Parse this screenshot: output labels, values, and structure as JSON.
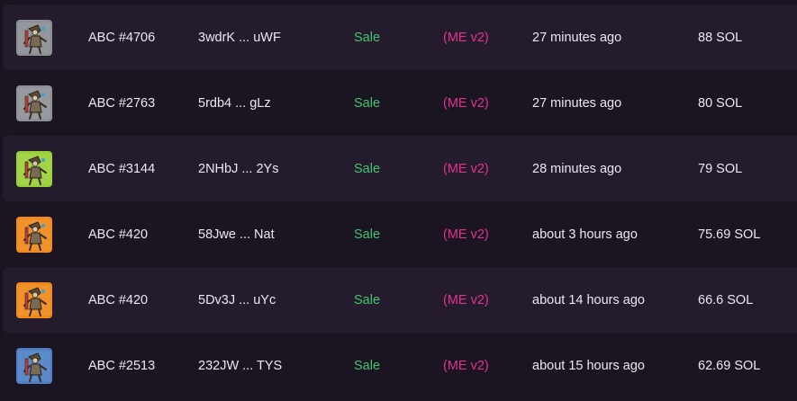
{
  "activity": {
    "rows": [
      {
        "name": "ABC #4706",
        "tx": "3wdrK ... uWF",
        "type": "Sale",
        "market": "(ME v2)",
        "time": "27 minutes ago",
        "price": "88 SOL",
        "thumb_bg": "#8a8f94",
        "thumb_icon": "nft-character-thumbnail"
      },
      {
        "name": "ABC #2763",
        "tx": "5rdb4 ... gLz",
        "type": "Sale",
        "market": "(ME v2)",
        "time": "27 minutes ago",
        "price": "80 SOL",
        "thumb_bg": "#8e9297",
        "thumb_icon": "nft-character-thumbnail"
      },
      {
        "name": "ABC #3144",
        "tx": "2NHbJ ... 2Ys",
        "type": "Sale",
        "market": "(ME v2)",
        "time": "28 minutes ago",
        "price": "79 SOL",
        "thumb_bg": "#9ad13a",
        "thumb_icon": "nft-character-thumbnail"
      },
      {
        "name": "ABC #420",
        "tx": "58Jwe ... Nat",
        "type": "Sale",
        "market": "(ME v2)",
        "time": "about 3 hours ago",
        "price": "75.69 SOL",
        "thumb_bg": "#f08a1c",
        "thumb_icon": "nft-character-thumbnail"
      },
      {
        "name": "ABC #420",
        "tx": "5Dv3J ... uYc",
        "type": "Sale",
        "market": "(ME v2)",
        "time": "about 14 hours ago",
        "price": "66.6 SOL",
        "thumb_bg": "#f08a1c",
        "thumb_icon": "nft-character-thumbnail"
      },
      {
        "name": "ABC #2513",
        "tx": "232JW ... TYS",
        "type": "Sale",
        "market": "(ME v2)",
        "time": "about 15 hours ago",
        "price": "62.69 SOL",
        "thumb_bg": "#4f7fc4",
        "thumb_icon": "nft-character-thumbnail"
      }
    ]
  },
  "colors": {
    "page_bg": "#1a1420",
    "row_odd_bg": "#241c2c",
    "row_even_bg": "#1b1521",
    "sale_text": "#3fc46f",
    "market_text": "#e0338f",
    "primary_text": "#ece7f2"
  }
}
